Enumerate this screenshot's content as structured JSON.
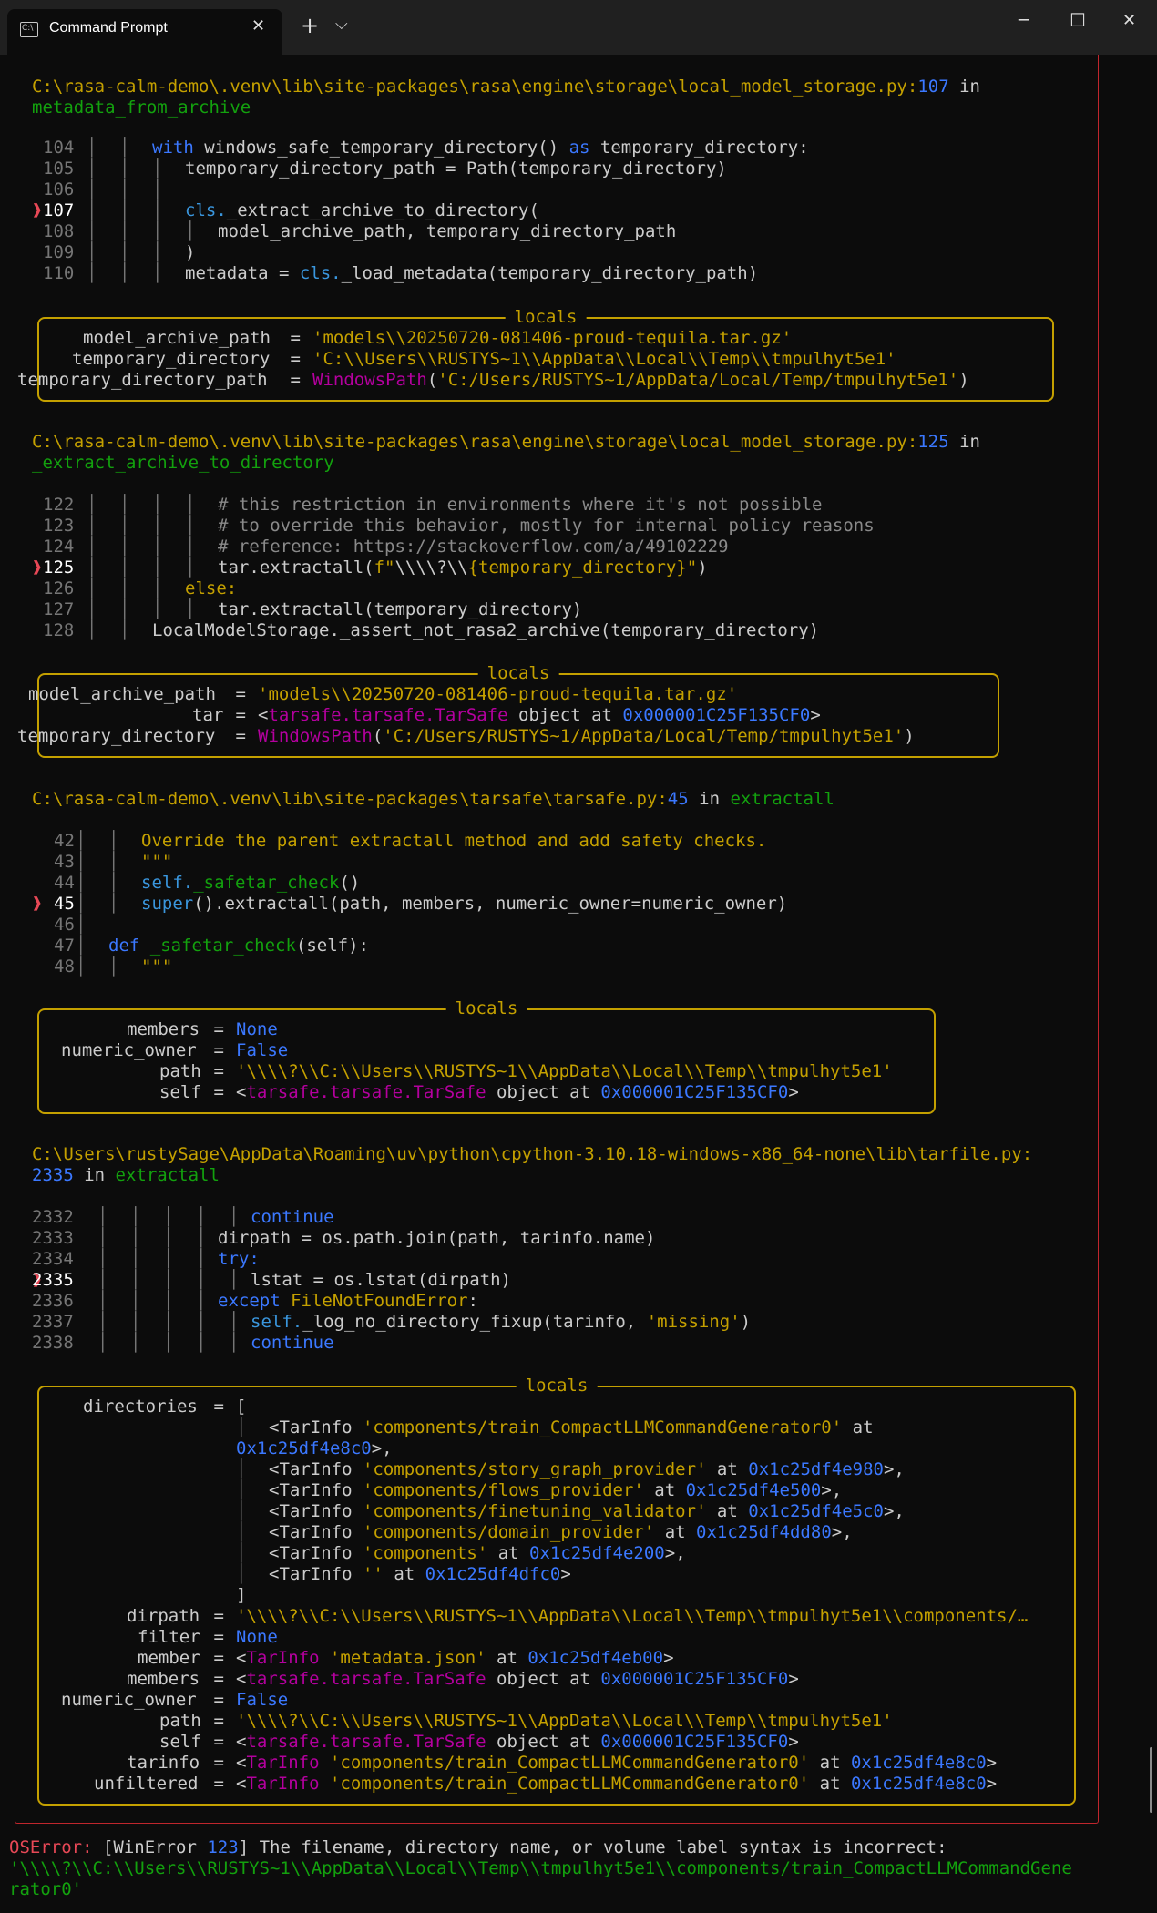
{
  "window": {
    "tab_title": "Command Prompt",
    "tab_icon_text": "C:\\",
    "new_tab": "+",
    "dropdown": "⌵",
    "minimize": "─",
    "maximize": "☐",
    "close": "✕",
    "tab_close": "✕"
  },
  "locals_label": "locals",
  "frames": [
    {
      "path": "C:\\rasa-calm-demo\\.venv\\lib\\site-packages\\rasa\\engine\\storage\\local_model_storage.py",
      "line": "107",
      "func": "metadata_from_archive",
      "code": [
        {
          "n": "104",
          "guide": "│   │   ",
          "text": "with windows_safe_temporary_directory() as temporary_directory:"
        },
        {
          "n": "105",
          "guide": "│   │   │   ",
          "text": "temporary_directory_path = Path(temporary_directory)"
        },
        {
          "n": "106",
          "guide": "│   │   │",
          "text": ""
        },
        {
          "n": "107",
          "guide": "│   │   │   ",
          "text": "cls._extract_archive_to_directory("
        },
        {
          "n": "108",
          "guide": "│   │   │   │   ",
          "text": "model_archive_path, temporary_directory_path"
        },
        {
          "n": "109",
          "guide": "│   │   │   ",
          "text": ")"
        },
        {
          "n": "110",
          "guide": "│   │   │   ",
          "text": "metadata = cls._load_metadata(temporary_directory_path)"
        }
      ],
      "locals": [
        {
          "k": "model_archive_path",
          "v": "'models\\\\20250720-081406-proud-tequila.tar.gz'"
        },
        {
          "k": "temporary_directory",
          "v": "'C:\\\\Users\\\\RUSTYS~1\\\\AppData\\\\Local\\\\Temp\\\\tmpulhyt5e1'"
        },
        {
          "k": "temporary_directory_path",
          "v": "WindowsPath('C:/Users/RUSTYS~1/AppData/Local/Temp/tmpulhyt5e1')"
        }
      ]
    },
    {
      "path": "C:\\rasa-calm-demo\\.venv\\lib\\site-packages\\rasa\\engine\\storage\\local_model_storage.py",
      "line": "125",
      "func": "_extract_archive_to_directory",
      "code": [
        {
          "n": "122",
          "text": "# this restriction in environments where it's not possible"
        },
        {
          "n": "123",
          "text": "# to override this behavior, mostly for internal policy reasons"
        },
        {
          "n": "124",
          "text": "# reference: https://stackoverflow.com/a/49102229"
        },
        {
          "n": "125",
          "text": "tar.extractall(f\"\\\\\\\\?\\\\{temporary_directory}\")"
        },
        {
          "n": "126",
          "text": "else:"
        },
        {
          "n": "127",
          "text": "tar.extractall(temporary_directory)"
        },
        {
          "n": "128",
          "text": "LocalModelStorage._assert_not_rasa2_archive(temporary_directory)"
        }
      ],
      "locals": [
        {
          "k": "model_archive_path",
          "v": "'models\\\\20250720-081406-proud-tequila.tar.gz'"
        },
        {
          "k": "tar",
          "v": "<tarsafe.tarsafe.TarSafe object at 0x000001C25F135CF0>"
        },
        {
          "k": "temporary_directory",
          "v": "WindowsPath('C:/Users/RUSTYS~1/AppData/Local/Temp/tmpulhyt5e1')"
        }
      ]
    },
    {
      "path": "C:\\rasa-calm-demo\\.venv\\lib\\site-packages\\tarsafe\\tarsafe.py",
      "line": "45",
      "func": "extractall",
      "code": [
        {
          "n": "42",
          "text": "Override the parent extractall method and add safety checks."
        },
        {
          "n": "43",
          "text": "\"\"\""
        },
        {
          "n": "44",
          "text": "self._safetar_check()"
        },
        {
          "n": "45",
          "text": "super().extractall(path, members, numeric_owner=numeric_owner)"
        },
        {
          "n": "46",
          "text": ""
        },
        {
          "n": "47",
          "text": "def _safetar_check(self):"
        },
        {
          "n": "48",
          "text": "\"\"\""
        }
      ],
      "locals": [
        {
          "k": "members",
          "v": "None"
        },
        {
          "k": "numeric_owner",
          "v": "False"
        },
        {
          "k": "path",
          "v": "'\\\\\\\\?\\\\C:\\\\Users\\\\RUSTYS~1\\\\AppData\\\\Local\\\\Temp\\\\tmpulhyt5e1'"
        },
        {
          "k": "self",
          "v": "<tarsafe.tarsafe.TarSafe object at 0x000001C25F135CF0>"
        }
      ]
    },
    {
      "path": "C:\\Users\\rustySage\\AppData\\Roaming\\uv\\python\\cpython-3.10.18-windows-x86_64-none\\lib\\tarfile.py:",
      "line": "2335",
      "func": "extractall",
      "code": [
        {
          "n": "2332",
          "text": "continue"
        },
        {
          "n": "2333",
          "text": "dirpath = os.path.join(path, tarinfo.name)"
        },
        {
          "n": "2334",
          "text": "try:"
        },
        {
          "n": "2335",
          "text": "lstat = os.lstat(dirpath)"
        },
        {
          "n": "2336",
          "text": "except FileNotFoundError:"
        },
        {
          "n": "2337",
          "text": "self._log_no_directory_fixup(tarinfo, 'missing')"
        },
        {
          "n": "2338",
          "text": "continue"
        }
      ],
      "locals": [
        {
          "k": "directories",
          "v": "["
        },
        {
          "k": "",
          "v": "<TarInfo 'components/train_CompactLLMCommandGenerator0' at 0x1c25df4e8c0>,"
        },
        {
          "k": "",
          "v": "<TarInfo 'components/story_graph_provider' at 0x1c25df4e980>,"
        },
        {
          "k": "",
          "v": "<TarInfo 'components/flows_provider' at 0x1c25df4e500>,"
        },
        {
          "k": "",
          "v": "<TarInfo 'components/finetuning_validator' at 0x1c25df4e5c0>,"
        },
        {
          "k": "",
          "v": "<TarInfo 'components/domain_provider' at 0x1c25df4dd80>,"
        },
        {
          "k": "",
          "v": "<TarInfo 'components' at 0x1c25df4e200>,"
        },
        {
          "k": "",
          "v": "<TarInfo '' at 0x1c25df4dfc0>"
        },
        {
          "k": "",
          "v": "]"
        },
        {
          "k": "dirpath",
          "v": "'\\\\\\\\?\\\\C:\\\\Users\\\\RUSTYS~1\\\\AppData\\\\Local\\\\Temp\\\\tmpulhyt5e1\\\\components/…"
        },
        {
          "k": "filter",
          "v": "None"
        },
        {
          "k": "member",
          "v": "<TarInfo 'metadata.json' at 0x1c25df4eb00>"
        },
        {
          "k": "members",
          "v": "<tarsafe.tarsafe.TarSafe object at 0x000001C25F135CF0>"
        },
        {
          "k": "numeric_owner",
          "v": "False"
        },
        {
          "k": "path",
          "v": "'\\\\\\\\?\\\\C:\\\\Users\\\\RUSTYS~1\\\\AppData\\\\Local\\\\Temp\\\\tmpulhyt5e1'"
        },
        {
          "k": "self",
          "v": "<tarsafe.tarsafe.TarSafe object at 0x000001C25F135CF0>"
        },
        {
          "k": "tarinfo",
          "v": "<TarInfo 'components/train_CompactLLMCommandGenerator0' at 0x1c25df4e8c0>"
        },
        {
          "k": "unfiltered",
          "v": "<TarInfo 'components/train_CompactLLMCommandGenerator0' at 0x1c25df4e8c0>"
        }
      ]
    }
  ],
  "error": {
    "type": "OSError:",
    "bracket_open": " [WinError ",
    "code": "123",
    "message": "] The filename, directory name, or volume label syntax is incorrect:",
    "value_line1": "'\\\\\\\\?\\\\C:\\\\Users\\\\RUSTYS~1\\\\AppData\\\\Local\\\\Temp\\\\tmpulhyt5e1\\\\components/train_CompactLLMCommandGene",
    "value_line2": "rator0'"
  },
  "text": {
    "in": " in",
    "colon": ":",
    "arrow": "❱",
    "eq": " = "
  },
  "colors": {
    "background": "#0c0c0c",
    "titlebar": "#202020",
    "frame_border": "#c0262d",
    "locals_border": "#c4a000",
    "path": "#c4a000",
    "func": "#13a10e",
    "number": "#3b78ff",
    "error": "#e74856"
  }
}
